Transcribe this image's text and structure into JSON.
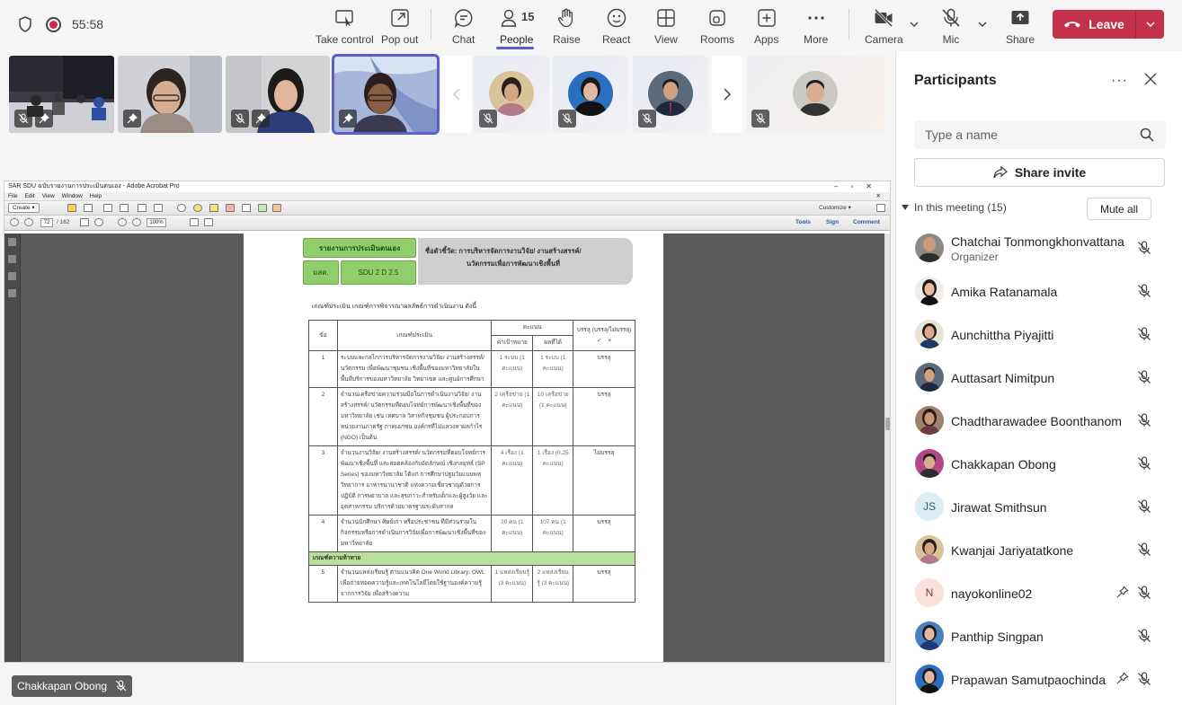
{
  "topbar": {
    "timer": "55:58",
    "people_count": "15",
    "buttons": {
      "take_control": "Take control",
      "pop_out": "Pop out",
      "chat": "Chat",
      "people": "People",
      "raise": "Raise",
      "react": "React",
      "view": "View",
      "rooms": "Rooms",
      "apps": "Apps",
      "more": "More",
      "camera": "Camera",
      "mic": "Mic",
      "share": "Share"
    },
    "leave_label": "Leave",
    "colors": {
      "accent": "#5b5fc7",
      "leave": "#c4314b"
    }
  },
  "acrobat": {
    "window_title": "SAR SDU ฉบับรายงานการประเมินตนเอง - Adobe Acrobat Pro",
    "menu": [
      "File",
      "Edit",
      "View",
      "Window",
      "Help"
    ],
    "create_label": "Create",
    "page_current": "72",
    "page_total": "/ 162",
    "zoom": "100%",
    "customize": "Customize",
    "tools": "Tools",
    "sign": "Sign",
    "comment": "Comment",
    "doc": {
      "report_label": "รายงานการประเมินตนเอง",
      "org_label": "มสด.",
      "code": "SDU 2 D 2.5",
      "indicator_title": "ชื่อตัวชี้วัด: การบริหารจัดการงานวิจัย/ งานสร้างสรรค์/",
      "indicator_title2": "นวัตกรรมเพื่อการพัฒนาเชิงพื้นที่",
      "criteria_heading": "เกณฑ์ประเมิน เกณฑ์การพิจารณาผลลัพธ์การดำเนินงาน ดังนี้",
      "col_no": "ข้อ",
      "col_criteria": "เกณฑ์ประเมิน",
      "col_score": "คะแนน",
      "col_target": "ค่าเป้าหมาย",
      "col_result": "ผลที่ได้",
      "col_achieve": "บรรลุ (บรรลุ/ไม่บรรลุ)",
      "col_check": "✓",
      "col_cross": "×",
      "rows": [
        {
          "no": "1",
          "text": "ระบบและกลไกการบริหารจัดการงานวิจัย/ งานสร้างสรรค์/ นวัตกรรม เพื่อพัฒนาชุมชน เชิงพื้นที่ของมหาวิทยาลัยในพื้นที่บริการของมหาวิทยาลัย วิทยาเขต และศูนย์การศึกษา",
          "target": "1 ระบบ (1 คะแนน)",
          "result": "1 ระบบ (1 คะแนน)",
          "achieved": "บรรลุ"
        },
        {
          "no": "2",
          "text": "จำนวนเครือข่ายความร่วมมือในการดำเนินงานวิจัย/ งานสร้างสรรค์/ นวัตกรรมที่ตอบโจทย์การพัฒนาเชิงพื้นที่ของมหาวิทยาลัย เช่น เทศบาล วิสาหกิจชุมชน ผู้ประกอบการ หน่วยงานภาครัฐ ภาคเอกชน องค์กรที่ไม่แสวงหาผลกำไร (NGO) เป็นต้น",
          "target": "2 เครือข่าย (1 คะแนน)",
          "result": "10 เครือข่าย (1 คะแนน)",
          "achieved": "บรรลุ"
        },
        {
          "no": "3",
          "text": "จำนวนงานวิจัย/ งานสร้างสรรค์/ นวัตกรรมที่ตอบโจทย์การพัฒนาเชิงพื้นที่ และสอดคล้องกับอัตลักษณ์ เชิงกลยุทธ์ (SP Series) ของมหาวิทยาลัย ได้แก่ การศึกษาปฐมวัยแบบพหุวิทยาการ อาหารนานาชาติ แห่งความเชี่ยวชาญด้วยการปฏิบัติ การพยาบาล และสุขภาวะสำหรับเด็กและผู้สูงวัย และอุตสาหกรรม บริการด้วยมาตรฐานระดับสากล",
          "target": "4 เรื่อง (1 คะแนน)",
          "result": "1 เรื่อง (0.25 คะแนน)",
          "achieved": "ไม่บรรลุ"
        },
        {
          "no": "4",
          "text": "จำนวนนักศึกษา ศิษย์เก่า หรือประชาชน ที่มีส่วนร่วมในกิจกรรมหรือการดำเนินการวิจัยเพื่อการพัฒนาเชิงพื้นที่ของมหาวิทยาลัย",
          "target": "20 คน (1 คะแนน)",
          "result": "107 คน (1 คะแนน)",
          "achieved": "บรรลุ"
        }
      ],
      "section_challenge": "เกณฑ์ความท้าทาย",
      "row5": {
        "no": "5",
        "text": "จำนวนแหล่งเรียนรู้ ตามแนวคิด One World Library: OWL เพื่อถ่ายทอดความรู้และเทคโนโลยีโดยใช้ฐานองค์ความรู้จากการวิจัย เพื่อสร้างความ",
        "target": "1 แหล่งเรียนรู้ (3 คะแนน)",
        "result": "2 แหล่งเรียนรู้ (3 คะแนน)",
        "achieved": "บรรลุ"
      }
    }
  },
  "speaker_tag": "Chakkapan Obong",
  "panel": {
    "title": "Participants",
    "search_placeholder": "Type a name",
    "share_invite": "Share invite",
    "section_label": "In this meeting (15)",
    "mute_all": "Mute all",
    "participants": [
      {
        "name": "Chatchai Tonmongkhonvattana",
        "role": "Organizer"
      },
      {
        "name": "Amika Ratanamala"
      },
      {
        "name": "Aunchittha Piyajitti"
      },
      {
        "name": "Auttasart Nimitpun"
      },
      {
        "name": "Chadtharawadee Boonthanom"
      },
      {
        "name": "Chakkapan Obong"
      },
      {
        "name": "Jirawat Smithsun",
        "initials": "JS"
      },
      {
        "name": "Kwanjai Jariyatatkone"
      },
      {
        "name": "nayokonline02",
        "initials": "N"
      },
      {
        "name": "Panthip Singpan"
      },
      {
        "name": "Prapawan Samutpaochinda"
      }
    ]
  }
}
